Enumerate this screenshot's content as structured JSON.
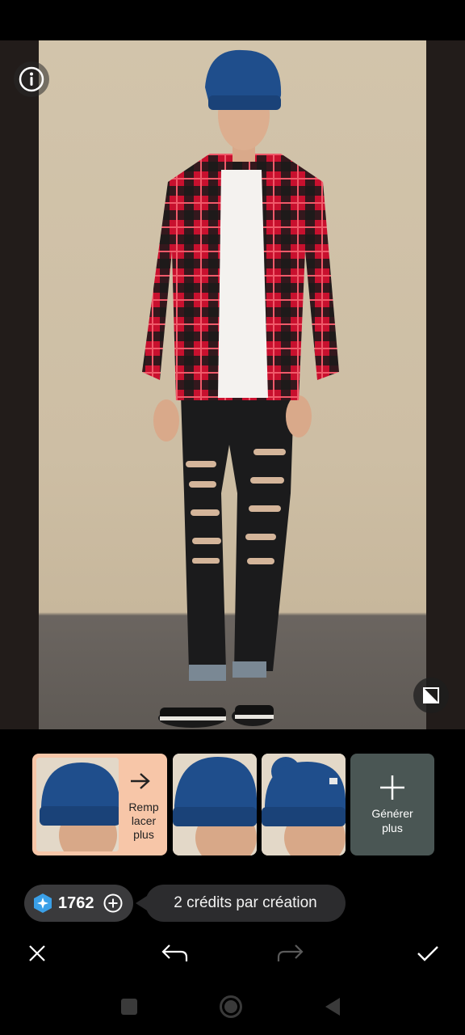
{
  "photo": {
    "description_icon": "info-icon"
  },
  "variants": {
    "selected": {
      "label": "Remp lacer plus",
      "line1": "Remp",
      "line2": "lacer",
      "line3": "plus"
    },
    "generate_more": {
      "line1": "Générer",
      "line2": "plus"
    }
  },
  "credits": {
    "value": "1762",
    "per_creation": "2 crédits par création"
  },
  "toolbar": {
    "close": "close-icon",
    "undo": "undo-icon",
    "redo": "redo-icon",
    "confirm": "check-icon"
  },
  "colors": {
    "accent": "#f7c6a8",
    "credit_pill": "#3a3a3c",
    "generate_tile": "#4a5654",
    "hat_blue": "#1f4e8c"
  }
}
